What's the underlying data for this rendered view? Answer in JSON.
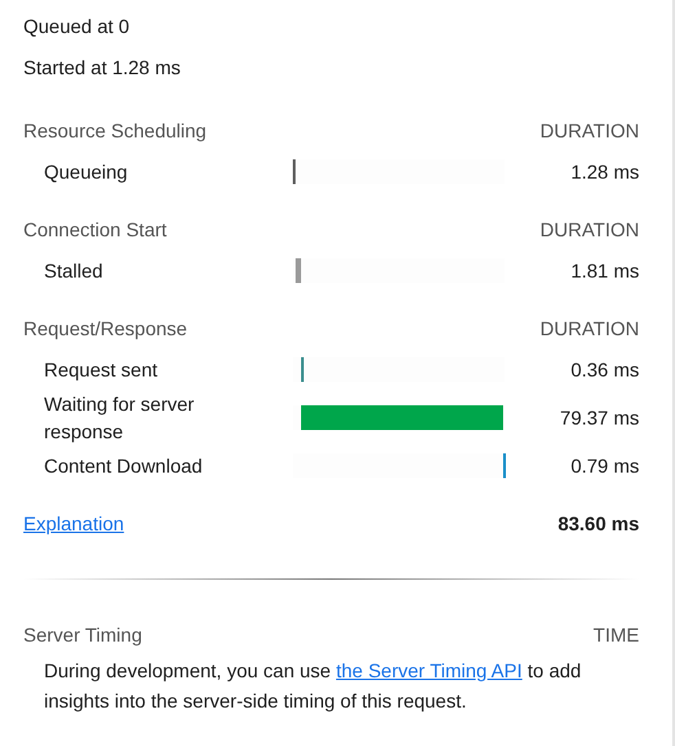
{
  "summary": [
    "Queued at 0",
    "Started at 1.28 ms"
  ],
  "sections": [
    {
      "title": "Resource Scheduling",
      "column": "DURATION",
      "rows": [
        {
          "label": "Queueing",
          "level": 0.0153,
          "color": "#5f5f5f",
          "reading": "1.28 ms"
        }
      ]
    },
    {
      "title": "Connection Start",
      "column": "DURATION",
      "rows": [
        {
          "label": "Stalled",
          "level": 0.0217,
          "color": "#9a9a9a",
          "reading": "1.81 ms"
        }
      ]
    },
    {
      "title": "Request/Response",
      "column": "DURATION",
      "rows": [
        {
          "label": "Request sent",
          "level": 0.0043,
          "color": "#3b8e8e",
          "reading": "0.36 ms"
        },
        {
          "label": "Waiting for server response",
          "level": 0.949,
          "color": "#00a64b",
          "reading": "79.37 ms"
        },
        {
          "label": "Content Download",
          "level": 0.0094,
          "color": "#1a8fc9",
          "reading": "0.79 ms"
        }
      ]
    }
  ],
  "footer": {
    "link": "Explanation",
    "total": "83.60 ms"
  },
  "server_timing": {
    "title": "Server Timing",
    "column": "TIME",
    "text_before": "During development, you can use ",
    "link": "the Server Timing API",
    "text_after": " to add insights into the server-side timing of this request."
  }
}
